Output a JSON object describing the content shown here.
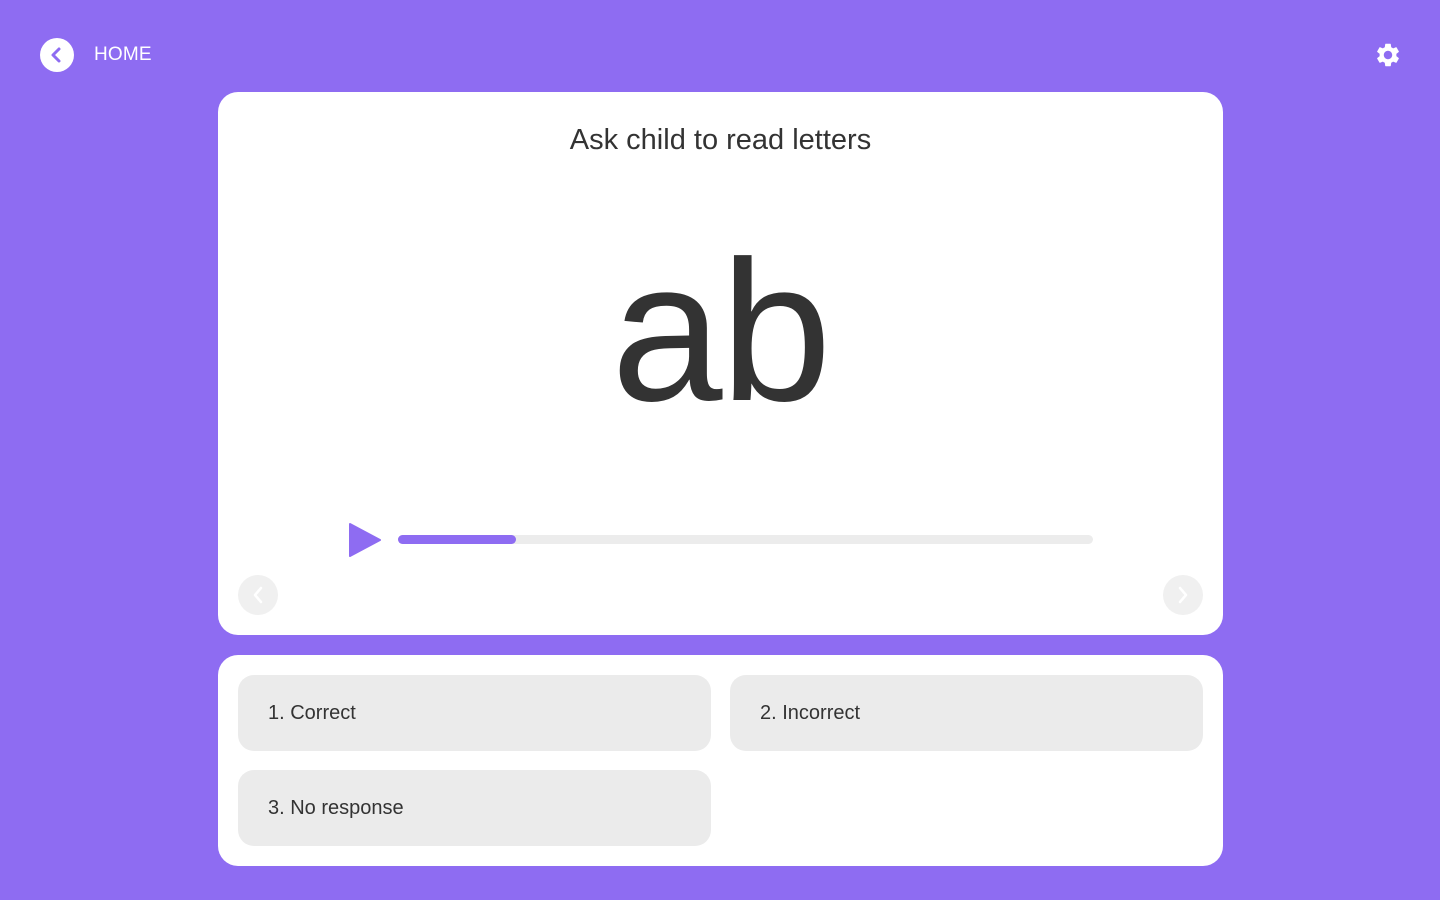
{
  "header": {
    "home_label": "HOME",
    "back_icon": "chevron-left-icon",
    "settings_icon": "gear-icon"
  },
  "card": {
    "instruction": "Ask child to read letters",
    "stimulus": "ab",
    "audio": {
      "play_icon": "play-icon",
      "progress_percent": 17
    },
    "prev_icon": "chevron-left-icon",
    "next_icon": "chevron-right-icon"
  },
  "responses": [
    {
      "label": "1. Correct"
    },
    {
      "label": "2. Incorrect"
    },
    {
      "label": "3. No response"
    }
  ],
  "colors": {
    "accent": "#8e6cf2",
    "card": "#ffffff",
    "button": "#ebebeb",
    "text": "#333333"
  }
}
